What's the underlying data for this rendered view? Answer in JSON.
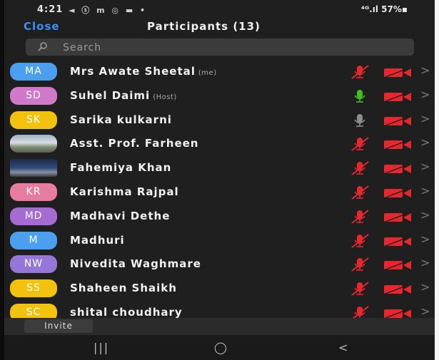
{
  "status": {
    "time": "4:21",
    "icons": "◄ ⓢ m ◎ ▬ •",
    "right": "⁴ᴳ.ıl 57%▪"
  },
  "header": {
    "close_label": "Close",
    "title": "Participants (13)"
  },
  "search": {
    "placeholder": "Search"
  },
  "participants": [
    {
      "initials": "MA",
      "name": "Mrs Awate Sheetal",
      "tag": "(me)",
      "color": "#4aa0ee",
      "mic": "muted"
    },
    {
      "initials": "SD",
      "name": "Suhel Daimi",
      "tag": "(Host)",
      "color": "#d079c9",
      "mic": "on"
    },
    {
      "initials": "SK",
      "name": "Sarika kulkarni",
      "tag": "",
      "color": "#f2c20c",
      "mic": "off"
    },
    {
      "initials": "",
      "name": "Asst. Prof. Farheen",
      "tag": "",
      "color": "#888888",
      "mic": "muted",
      "photo": "photo1"
    },
    {
      "initials": "",
      "name": "Fahemiya Khan",
      "tag": "",
      "color": "#333a55",
      "mic": "muted",
      "photo": "photo2"
    },
    {
      "initials": "KR",
      "name": "Karishma Rajpal",
      "tag": "",
      "color": "#e77ba0",
      "mic": "muted"
    },
    {
      "initials": "MD",
      "name": "Madhavi Dethe",
      "tag": "",
      "color": "#a56bd3",
      "mic": "muted"
    },
    {
      "initials": "M",
      "name": "Madhuri",
      "tag": "",
      "color": "#4aa0ee",
      "mic": "muted"
    },
    {
      "initials": "NW",
      "name": "Nivedita Waghmare",
      "tag": "",
      "color": "#9576d8",
      "mic": "muted"
    },
    {
      "initials": "SS",
      "name": "Shaheen Shaikh",
      "tag": "",
      "color": "#f2c20c",
      "mic": "muted"
    },
    {
      "initials": "SC",
      "name": "shital choudhary",
      "tag": "",
      "color": "#f2c20c",
      "mic": "muted"
    }
  ],
  "footer": {
    "invite_label": "Invite"
  },
  "nav": {
    "recent": "|||",
    "home": "◯",
    "back": "<"
  },
  "colors": {
    "muted_red": "#e8262d",
    "mic_green": "#3fc11a",
    "mic_grey": "#8d8d8d",
    "accent": "#3d8ef0"
  }
}
